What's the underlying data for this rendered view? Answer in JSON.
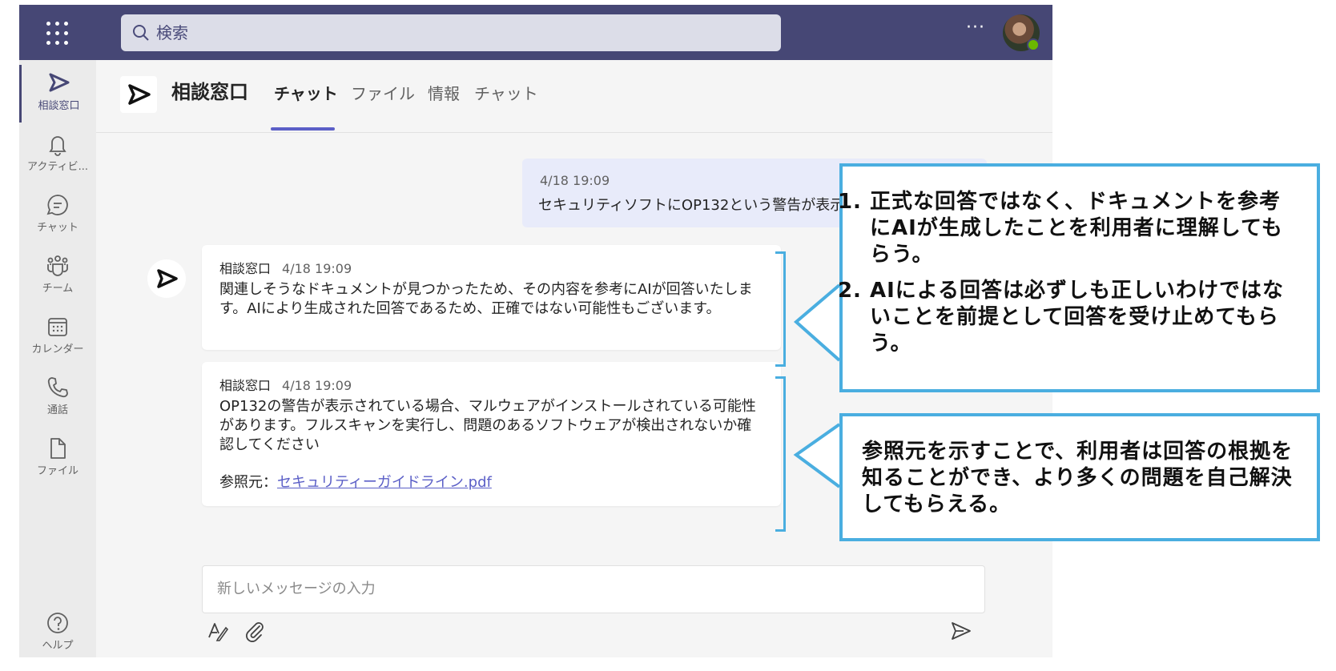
{
  "search": {
    "placeholder": "検索"
  },
  "topbar": {
    "more_label": "···"
  },
  "rail": {
    "items": [
      {
        "label": "相談窓口",
        "icon": "send-icon"
      },
      {
        "label": "アクティビ...",
        "icon": "bell-icon"
      },
      {
        "label": "チャット",
        "icon": "chat-icon"
      },
      {
        "label": "チーム",
        "icon": "teams-icon"
      },
      {
        "label": "カレンダー",
        "icon": "calendar-icon"
      },
      {
        "label": "通話",
        "icon": "phone-icon"
      },
      {
        "label": "ファイル",
        "icon": "file-icon"
      }
    ],
    "help_label": "ヘルプ"
  },
  "header": {
    "team_name": "相談窓口",
    "tabs": [
      "チャット",
      "ファイル",
      "情報",
      "チャット"
    ]
  },
  "messages": {
    "outgoing": {
      "time": "4/18 19:09",
      "text": "セキュリティソフトにOP132という警告が表示"
    },
    "bot1": {
      "sender": "相談窓口",
      "time": "4/18 19:09",
      "text": "関連しそうなドキュメントが見つかったため、その内容を参考にAIが回答いたします。AIにより生成された回答であるため、正確ではない可能性もございます。"
    },
    "bot2": {
      "sender": "相談窓口",
      "time": "4/18 19:09",
      "text": "OP132の警告が表示されている場合、マルウェアがインストールされている可能性があります。フルスキャンを実行し、問題のあるソフトウェアが検出されないか確認してください",
      "ref_label": "参照元：",
      "ref_link": "セキュリティーガイドライン.pdf"
    }
  },
  "compose": {
    "placeholder": "新しいメッセージの入力"
  },
  "callouts": {
    "first": [
      "正式な回答ではなく、ドキュメントを参考にAIが生成したことを利用者に理解してもらう。",
      "AIによる回答は必ずしも正しいわけではないことを前提として回答を受け止めてもらう。"
    ],
    "second": "参照元を示すことで、利用者は回答の根拠を知ることができ、より多くの問題を自己解決してもらえる。"
  },
  "colors": {
    "topbar": "#464775",
    "accent": "#5b5fc7",
    "callout_border": "#4aaee0",
    "presence": "#6bb700"
  }
}
